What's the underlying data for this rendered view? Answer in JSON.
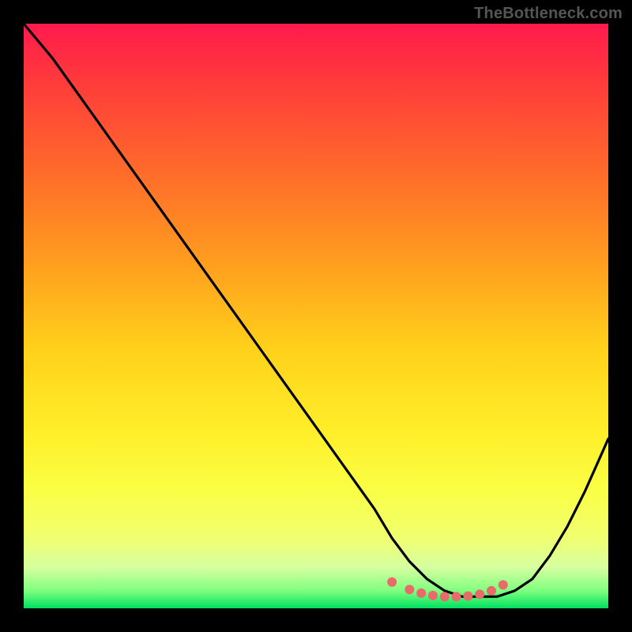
{
  "watermark": "TheBottleneck.com",
  "chart_data": {
    "type": "line",
    "title": "",
    "xlabel": "",
    "ylabel": "",
    "xlim": [
      0,
      100
    ],
    "ylim": [
      0,
      100
    ],
    "series": [
      {
        "name": "bottleneck-curve",
        "x": [
          0,
          5,
          10,
          15,
          20,
          25,
          30,
          35,
          40,
          45,
          50,
          55,
          60,
          63,
          66,
          69,
          72,
          75,
          78,
          81,
          84,
          87,
          90,
          93,
          96,
          100
        ],
        "values": [
          100,
          94,
          87,
          80,
          73,
          66,
          59,
          52,
          45,
          38,
          31,
          24,
          17,
          12,
          8,
          5,
          3,
          2,
          2,
          2,
          3,
          5,
          9,
          14,
          20,
          29
        ]
      }
    ],
    "markers": {
      "name": "highlight-dots",
      "x": [
        63,
        66,
        68,
        70,
        72,
        74,
        76,
        78,
        80,
        82
      ],
      "values": [
        4.5,
        3.2,
        2.6,
        2.2,
        2.0,
        2.0,
        2.1,
        2.4,
        3.0,
        4.0
      ]
    }
  }
}
